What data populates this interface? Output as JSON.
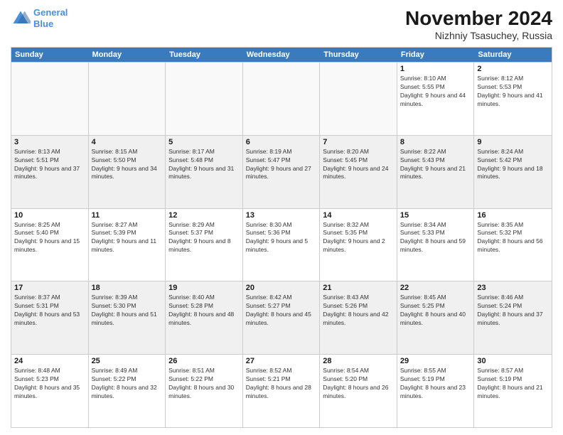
{
  "logo": {
    "line1": "General",
    "line2": "Blue"
  },
  "title": "November 2024",
  "subtitle": "Nizhniy Tsasuchey, Russia",
  "days": [
    "Sunday",
    "Monday",
    "Tuesday",
    "Wednesday",
    "Thursday",
    "Friday",
    "Saturday"
  ],
  "rows": [
    [
      {
        "day": "",
        "info": ""
      },
      {
        "day": "",
        "info": ""
      },
      {
        "day": "",
        "info": ""
      },
      {
        "day": "",
        "info": ""
      },
      {
        "day": "",
        "info": ""
      },
      {
        "day": "1",
        "info": "Sunrise: 8:10 AM\nSunset: 5:55 PM\nDaylight: 9 hours and 44 minutes."
      },
      {
        "day": "2",
        "info": "Sunrise: 8:12 AM\nSunset: 5:53 PM\nDaylight: 9 hours and 41 minutes."
      }
    ],
    [
      {
        "day": "3",
        "info": "Sunrise: 8:13 AM\nSunset: 5:51 PM\nDaylight: 9 hours and 37 minutes."
      },
      {
        "day": "4",
        "info": "Sunrise: 8:15 AM\nSunset: 5:50 PM\nDaylight: 9 hours and 34 minutes."
      },
      {
        "day": "5",
        "info": "Sunrise: 8:17 AM\nSunset: 5:48 PM\nDaylight: 9 hours and 31 minutes."
      },
      {
        "day": "6",
        "info": "Sunrise: 8:19 AM\nSunset: 5:47 PM\nDaylight: 9 hours and 27 minutes."
      },
      {
        "day": "7",
        "info": "Sunrise: 8:20 AM\nSunset: 5:45 PM\nDaylight: 9 hours and 24 minutes."
      },
      {
        "day": "8",
        "info": "Sunrise: 8:22 AM\nSunset: 5:43 PM\nDaylight: 9 hours and 21 minutes."
      },
      {
        "day": "9",
        "info": "Sunrise: 8:24 AM\nSunset: 5:42 PM\nDaylight: 9 hours and 18 minutes."
      }
    ],
    [
      {
        "day": "10",
        "info": "Sunrise: 8:25 AM\nSunset: 5:40 PM\nDaylight: 9 hours and 15 minutes."
      },
      {
        "day": "11",
        "info": "Sunrise: 8:27 AM\nSunset: 5:39 PM\nDaylight: 9 hours and 11 minutes."
      },
      {
        "day": "12",
        "info": "Sunrise: 8:29 AM\nSunset: 5:37 PM\nDaylight: 9 hours and 8 minutes."
      },
      {
        "day": "13",
        "info": "Sunrise: 8:30 AM\nSunset: 5:36 PM\nDaylight: 9 hours and 5 minutes."
      },
      {
        "day": "14",
        "info": "Sunrise: 8:32 AM\nSunset: 5:35 PM\nDaylight: 9 hours and 2 minutes."
      },
      {
        "day": "15",
        "info": "Sunrise: 8:34 AM\nSunset: 5:33 PM\nDaylight: 8 hours and 59 minutes."
      },
      {
        "day": "16",
        "info": "Sunrise: 8:35 AM\nSunset: 5:32 PM\nDaylight: 8 hours and 56 minutes."
      }
    ],
    [
      {
        "day": "17",
        "info": "Sunrise: 8:37 AM\nSunset: 5:31 PM\nDaylight: 8 hours and 53 minutes."
      },
      {
        "day": "18",
        "info": "Sunrise: 8:39 AM\nSunset: 5:30 PM\nDaylight: 8 hours and 51 minutes."
      },
      {
        "day": "19",
        "info": "Sunrise: 8:40 AM\nSunset: 5:28 PM\nDaylight: 8 hours and 48 minutes."
      },
      {
        "day": "20",
        "info": "Sunrise: 8:42 AM\nSunset: 5:27 PM\nDaylight: 8 hours and 45 minutes."
      },
      {
        "day": "21",
        "info": "Sunrise: 8:43 AM\nSunset: 5:26 PM\nDaylight: 8 hours and 42 minutes."
      },
      {
        "day": "22",
        "info": "Sunrise: 8:45 AM\nSunset: 5:25 PM\nDaylight: 8 hours and 40 minutes."
      },
      {
        "day": "23",
        "info": "Sunrise: 8:46 AM\nSunset: 5:24 PM\nDaylight: 8 hours and 37 minutes."
      }
    ],
    [
      {
        "day": "24",
        "info": "Sunrise: 8:48 AM\nSunset: 5:23 PM\nDaylight: 8 hours and 35 minutes."
      },
      {
        "day": "25",
        "info": "Sunrise: 8:49 AM\nSunset: 5:22 PM\nDaylight: 8 hours and 32 minutes."
      },
      {
        "day": "26",
        "info": "Sunrise: 8:51 AM\nSunset: 5:22 PM\nDaylight: 8 hours and 30 minutes."
      },
      {
        "day": "27",
        "info": "Sunrise: 8:52 AM\nSunset: 5:21 PM\nDaylight: 8 hours and 28 minutes."
      },
      {
        "day": "28",
        "info": "Sunrise: 8:54 AM\nSunset: 5:20 PM\nDaylight: 8 hours and 26 minutes."
      },
      {
        "day": "29",
        "info": "Sunrise: 8:55 AM\nSunset: 5:19 PM\nDaylight: 8 hours and 23 minutes."
      },
      {
        "day": "30",
        "info": "Sunrise: 8:57 AM\nSunset: 5:19 PM\nDaylight: 8 hours and 21 minutes."
      }
    ]
  ]
}
